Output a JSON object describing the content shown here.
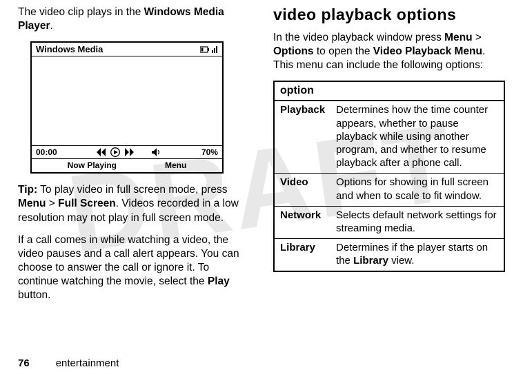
{
  "left": {
    "intro_pre": "The video clip plays in the ",
    "intro_bold": "Windows Media Player",
    "intro_post": ".",
    "tip_label": "Tip:",
    "tip_text1": " To play video in full screen mode, press ",
    "tip_menu": "Menu",
    "tip_gt": " > ",
    "tip_fs": "Full Screen",
    "tip_text2": ". Videos recorded in a low resolution may not play in full screen mode.",
    "call_text1": "If a call comes in while watching a video, the video pauses and a call alert appears. You can choose to answer the call or ignore it. To continue watching the movie, select the ",
    "call_play": "Play",
    "call_text2": " button."
  },
  "player": {
    "title": "Windows Media",
    "time": "00:00",
    "pct": "70%",
    "soft_left": "Now Playing",
    "soft_right": "Menu"
  },
  "right": {
    "heading": "video playback options",
    "intro_pre": "In the video playback window press ",
    "intro_menu": "Menu",
    "intro_gt": " >",
    "intro_opts": "Options",
    "intro_mid": " to open the ",
    "intro_vpm": "Video Playback Menu",
    "intro_post": ". This menu can include the following options:",
    "table": {
      "header": "option",
      "rows": [
        {
          "name": "Playback",
          "desc": "Determines how the time counter appears, whether to pause playback while using another program, and whether to resume playback after a phone call."
        },
        {
          "name": "Video",
          "desc": "Options for showing in full screen and when to scale to fit window."
        },
        {
          "name": "Network",
          "desc": "Selects default network settings for streaming media."
        },
        {
          "name": "Library",
          "desc_pre": "Determines if the player starts on the ",
          "desc_bold": "Library",
          "desc_post": " view."
        }
      ]
    }
  },
  "footer": {
    "page": "76",
    "section": "entertainment"
  }
}
